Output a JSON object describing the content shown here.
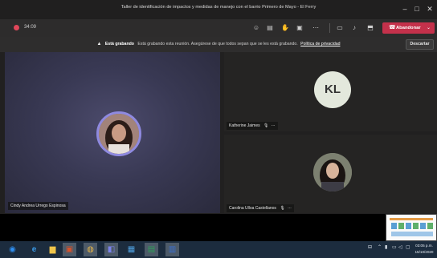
{
  "window": {
    "title": "Taller de identificación de impactos y medidas de manejo con el barrio Primero de Mayo - El Ferry",
    "minimize_icon": "minimize-icon",
    "maximize_icon": "maximize-icon",
    "close_icon": "close-icon"
  },
  "toolbar": {
    "timer": "34:09",
    "icons": [
      "participants-icon",
      "chat-icon",
      "raise-hand-icon",
      "breakout-rooms-icon",
      "more-actions-icon",
      "camera-off-icon",
      "mic-off-icon",
      "share-screen-icon"
    ],
    "leave_label": "Abandonar",
    "colors": {
      "leave": "#c4314b",
      "recording": "#e0475a"
    }
  },
  "recording_banner": {
    "bold": "Está grabando",
    "message": "Está grabando esta reunión. Asegúrese de que todos sepan que se les está grabando.",
    "link": "Política de privacidad",
    "dismiss_label": "Descartar"
  },
  "participants": [
    {
      "name": "Cindy Andrea Urrego Espinosa",
      "avatar": "photo"
    },
    {
      "name": "Katherine Jaimes",
      "initials": "KL",
      "avatar": "initials"
    },
    {
      "name": "Carolina Ulloa Castellanos",
      "avatar": "photo"
    }
  ],
  "taskbar": {
    "apps": [
      "start-icon",
      "edge-icon",
      "file-explorer-icon",
      "powerpoint-icon",
      "chrome-icon",
      "teams-icon",
      "photos-icon",
      "excel-icon",
      "word-icon"
    ],
    "clock_time": "03:05 p.m.",
    "clock_date": "15/10/2020"
  }
}
